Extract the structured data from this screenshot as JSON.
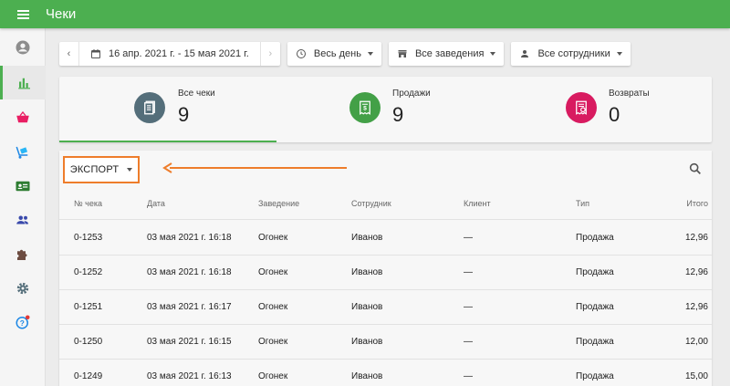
{
  "app": {
    "title": "Чеки"
  },
  "filters": {
    "date_range": "16 апр. 2021 г. - 15 мая 2021 г.",
    "time": "Весь день",
    "stores": "Все заведения",
    "employees": "Все сотрудники"
  },
  "summary": [
    {
      "label": "Все чеки",
      "value": "9",
      "color": "#546e7a",
      "icon": "receipts-icon"
    },
    {
      "label": "Продажи",
      "value": "9",
      "color": "#43a047",
      "icon": "sale-receipt-icon"
    },
    {
      "label": "Возвраты",
      "value": "0",
      "color": "#d81b60",
      "icon": "refund-receipt-icon"
    }
  ],
  "toolbar": {
    "export_label": "ЭКСПОРТ"
  },
  "table": {
    "columns": [
      "№ чека",
      "Дата",
      "Заведение",
      "Сотрудник",
      "Клиент",
      "Тип",
      "Итого"
    ],
    "rows": [
      [
        "0-1253",
        "03 мая 2021 г. 16:18",
        "Огонек",
        "Иванов",
        "—",
        "Продажа",
        "12,96"
      ],
      [
        "0-1252",
        "03 мая 2021 г. 16:18",
        "Огонек",
        "Иванов",
        "—",
        "Продажа",
        "12,96"
      ],
      [
        "0-1251",
        "03 мая 2021 г. 16:17",
        "Огонек",
        "Иванов",
        "—",
        "Продажа",
        "12,96"
      ],
      [
        "0-1250",
        "03 мая 2021 г. 16:15",
        "Огонек",
        "Иванов",
        "—",
        "Продажа",
        "12,00"
      ],
      [
        "0-1249",
        "03 мая 2021 г. 16:13",
        "Огонек",
        "Иванов",
        "—",
        "Продажа",
        "15,00"
      ]
    ]
  },
  "colors": {
    "brand": "#4caf50",
    "highlight": "#ee7d2b"
  }
}
